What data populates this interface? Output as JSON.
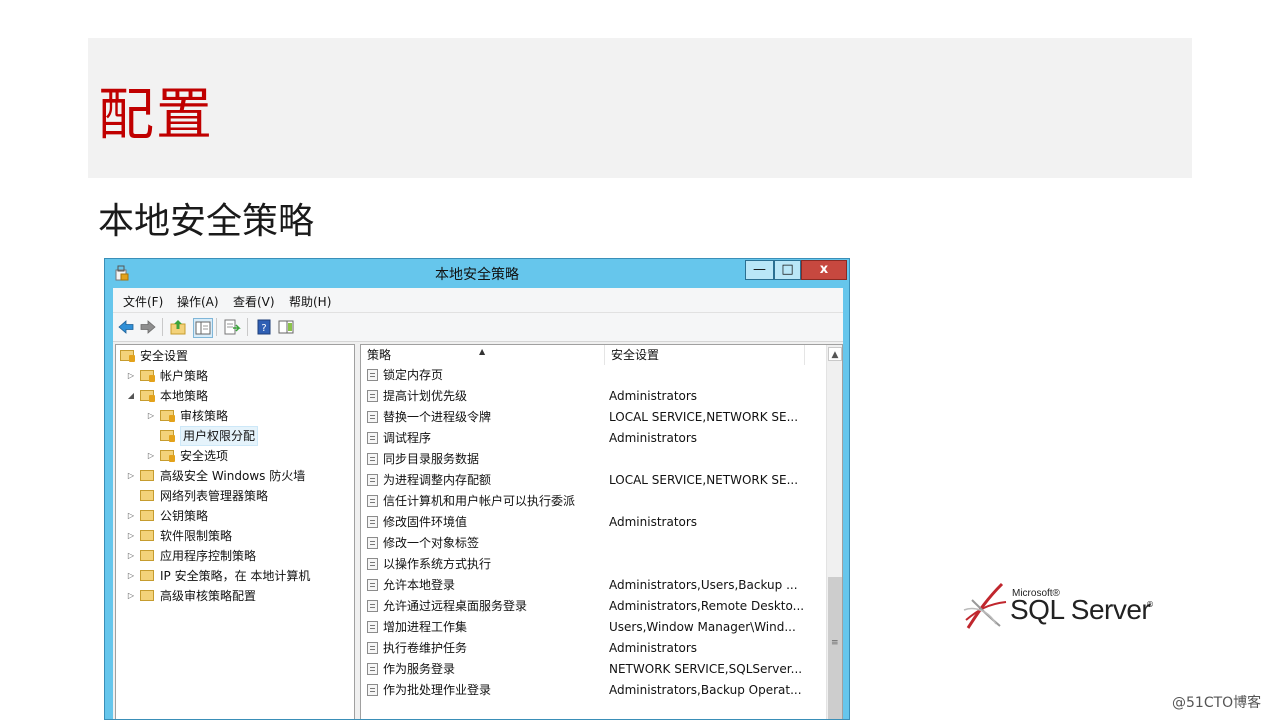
{
  "slide": {
    "title": "配置",
    "subtitle": "本地安全策略",
    "watermark": "@51CTO博客"
  },
  "window": {
    "title": "本地安全策略",
    "controls": {
      "minimize": "—",
      "maximize": "□",
      "close": "x"
    },
    "menu": [
      "文件(F)",
      "操作(A)",
      "查看(V)",
      "帮助(H)"
    ],
    "tree": [
      {
        "label": "安全设置",
        "level": 0,
        "arrow": ""
      },
      {
        "label": "帐户策略",
        "level": 1,
        "arrow": "▷"
      },
      {
        "label": "本地策略",
        "level": 1,
        "arrow": "◢"
      },
      {
        "label": "审核策略",
        "level": 2,
        "arrow": "▷"
      },
      {
        "label": "用户权限分配",
        "level": 2,
        "arrow": "",
        "selected": true
      },
      {
        "label": "安全选项",
        "level": 2,
        "arrow": "▷"
      },
      {
        "label": "高级安全 Windows 防火墙",
        "level": 1,
        "arrow": "▷"
      },
      {
        "label": "网络列表管理器策略",
        "level": 1,
        "arrow": ""
      },
      {
        "label": "公钥策略",
        "level": 1,
        "arrow": "▷"
      },
      {
        "label": "软件限制策略",
        "level": 1,
        "arrow": "▷"
      },
      {
        "label": "应用程序控制策略",
        "level": 1,
        "arrow": "▷"
      },
      {
        "label": "IP 安全策略，在 本地计算机",
        "level": 1,
        "arrow": "▷"
      },
      {
        "label": "高级审核策略配置",
        "level": 1,
        "arrow": "▷"
      }
    ],
    "columns": {
      "policy": "策略",
      "setting": "安全设置"
    },
    "rows": [
      {
        "policy": "锁定内存页",
        "setting": ""
      },
      {
        "policy": "提高计划优先级",
        "setting": "Administrators"
      },
      {
        "policy": "替换一个进程级令牌",
        "setting": "LOCAL SERVICE,NETWORK SE..."
      },
      {
        "policy": "调试程序",
        "setting": "Administrators"
      },
      {
        "policy": "同步目录服务数据",
        "setting": ""
      },
      {
        "policy": "为进程调整内存配额",
        "setting": "LOCAL SERVICE,NETWORK SE..."
      },
      {
        "policy": "信任计算机和用户帐户可以执行委派",
        "setting": ""
      },
      {
        "policy": "修改固件环境值",
        "setting": "Administrators"
      },
      {
        "policy": "修改一个对象标签",
        "setting": ""
      },
      {
        "policy": "以操作系统方式执行",
        "setting": ""
      },
      {
        "policy": "允许本地登录",
        "setting": "Administrators,Users,Backup ..."
      },
      {
        "policy": "允许通过远程桌面服务登录",
        "setting": "Administrators,Remote Deskto..."
      },
      {
        "policy": "增加进程工作集",
        "setting": "Users,Window Manager\\Wind..."
      },
      {
        "policy": "执行卷维护任务",
        "setting": "Administrators"
      },
      {
        "policy": "作为服务登录",
        "setting": "NETWORK SERVICE,SQLServer..."
      },
      {
        "policy": "作为批处理作业登录",
        "setting": "Administrators,Backup Operat..."
      }
    ]
  },
  "logo": {
    "brand": "Microsoft®",
    "product": "SQL Server",
    "trademark": "®"
  },
  "colors": {
    "title_red": "#c00000",
    "window_frame": "#66c6ec",
    "close_button": "#c7483f"
  }
}
